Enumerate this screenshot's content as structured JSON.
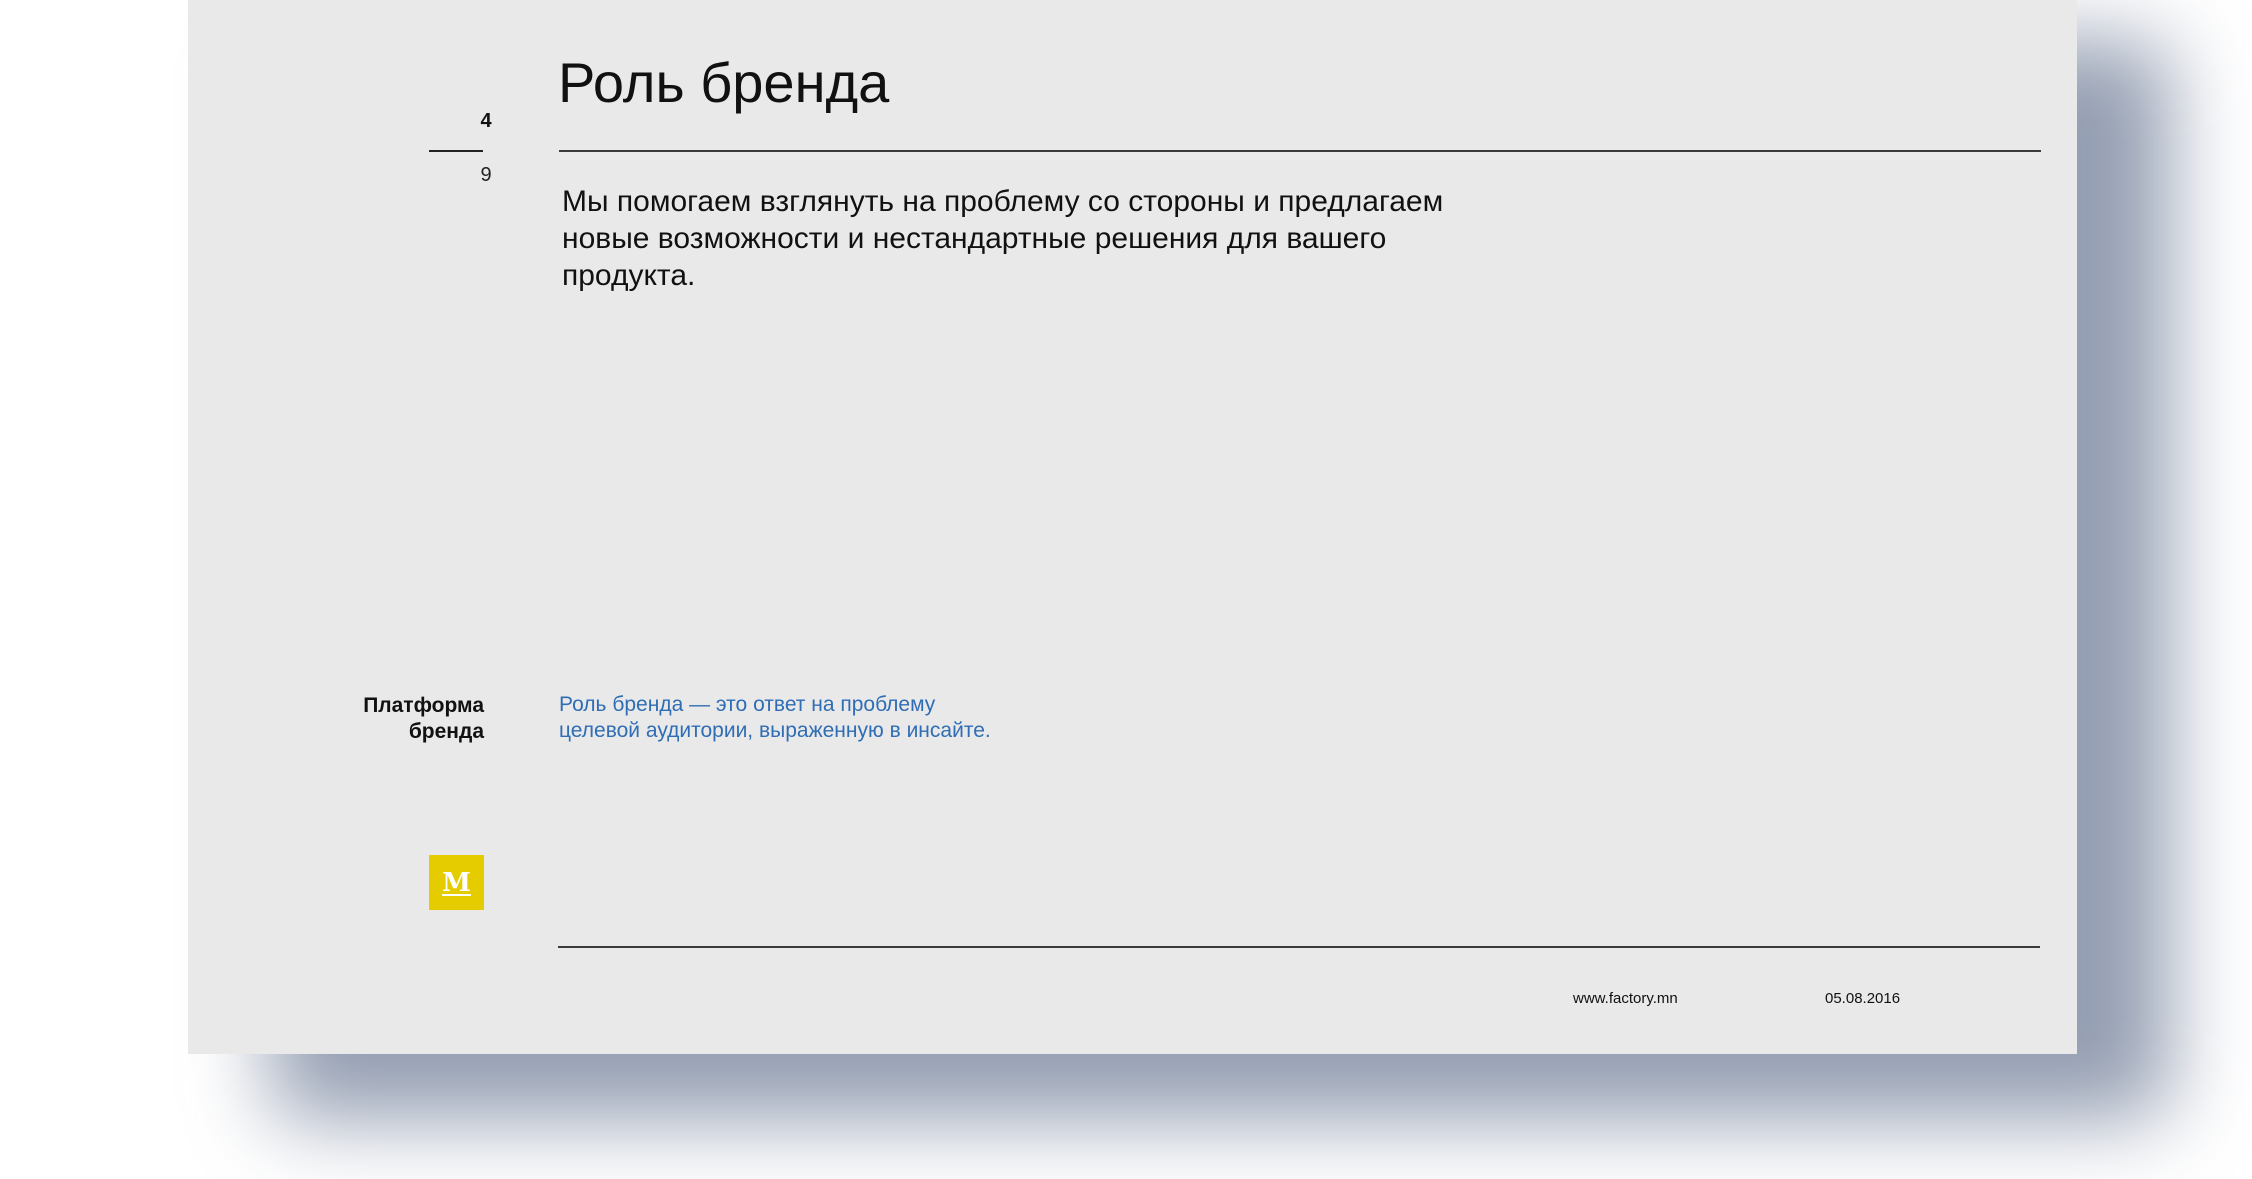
{
  "page_number": {
    "current": "4",
    "total": "9"
  },
  "title": "Роль бренда",
  "lead_text": "Мы помогаем взглянуть на проблему со стороны и предлагаем новые возможности и нестандартные решения для вашего продукта.",
  "section_label": {
    "line1": "Платформа",
    "line2": "бренда"
  },
  "note": {
    "line1": "Роль бренда — это ответ на проблему",
    "line2": "целевой аудитории, выраженную в инсайте."
  },
  "logo": {
    "letter": "M",
    "color": "#e4cc00"
  },
  "footer": {
    "url": "www.factory.mn",
    "date": "05.08.2016"
  },
  "colors": {
    "slide_background": "#e9e9ea",
    "accent_blue": "#2f6db4",
    "text": "#111111"
  }
}
